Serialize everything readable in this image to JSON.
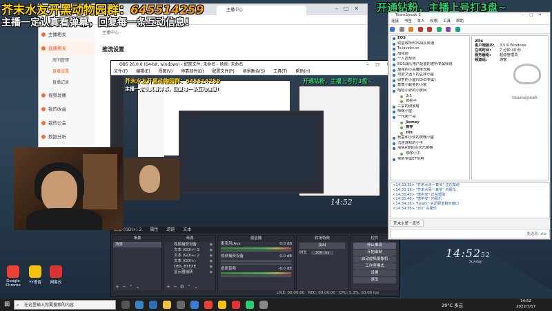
{
  "overlay": {
    "title_line1": "芥末水友开黑动物园群：",
    "qq_number": "645514259",
    "title_line2": "主播一定认真看弹幕，回复每一条互动信息!",
    "right_banner": "开通钻粉，主播上号打3盘~"
  },
  "browser": {
    "tab_title": "主播中心",
    "crumb": "主播中心",
    "section_header": "推流设置",
    "sidebar": [
      {
        "label": "主播相关",
        "type": "group"
      },
      {
        "label": "直播相关",
        "type": "group",
        "active": true
      },
      {
        "label": "房间管理",
        "type": "sub"
      },
      {
        "label": "直播设置",
        "type": "sub",
        "active": true
      },
      {
        "label": "直播记录",
        "type": "sub"
      },
      {
        "label": "视频发播",
        "type": "group"
      },
      {
        "label": "我的收益",
        "type": "group"
      },
      {
        "label": "我的公会",
        "type": "group"
      },
      {
        "label": "数据分析",
        "type": "group"
      }
    ]
  },
  "obs": {
    "title": "OBS 26.0.0 (64-bit, windows) - 配置文件: 未命名 - 场景: 未命名",
    "menu": [
      "文件(F)",
      "编辑(E)",
      "视图(V)",
      "停靠部件(D)",
      "配置文件(P)",
      "场景集合(S)",
      "工具(T)",
      "帮助(H)"
    ],
    "studio_bar": [
      "文本 (GDI+) 2",
      "属性",
      "滤镜",
      "文本"
    ],
    "docks": {
      "scenes_header": "场景",
      "sources_header": "来源",
      "mixer_header": "混音器",
      "transitions_header": "转场特效",
      "controls_header": "控件"
    },
    "scenes": [
      "场景"
    ],
    "sources": [
      "视频捕获设备",
      "文本 (GDI+) 3",
      "文本 (GDI+) 2",
      "文本 (GDI+)",
      "OBS_BTEXE",
      "显示器捕获"
    ],
    "mixer": [
      {
        "name": "麦克风/Aux",
        "value": "0.0 dB",
        "active": true
      },
      {
        "name": "视频捕获设备",
        "value": "0.0 dB",
        "active": false
      },
      {
        "name": "桌面音频",
        "value": "-6.0 dB",
        "active": true
      }
    ],
    "transition": {
      "name": "淡出",
      "duration_label": "时长",
      "duration": "300 ms"
    },
    "controls": [
      "停止推流",
      "开始录制",
      "启动虚拟摄像机",
      "工作室模式",
      "设置",
      "退出"
    ],
    "status": {
      "live": "LIVE: 00:00:00",
      "rec": "REC: 00:00:00",
      "cpu": "CPU: 5.3%, 60.00 fps"
    }
  },
  "teamspeak": {
    "title": "TeamSpeak 3",
    "menu": [
      "连接",
      "书签",
      "本人",
      "权限",
      "工具",
      "帮助"
    ],
    "tree": [
      {
        "label": "EOS",
        "kind": "server",
        "bold": true
      },
      {
        "label": "欢迎收听EOS战队频道",
        "kind": "channel"
      },
      {
        "label": "Ts.lovekv.cn",
        "kind": "channel"
      },
      {
        "label": "加我前",
        "kind": "channel"
      },
      {
        "label": "一人员规则",
        "kind": "channel"
      },
      {
        "label": "EOS战队用户配置的老听专属频道",
        "kind": "channel"
      },
      {
        "label": "最强的小恶魔推流房",
        "kind": "channel"
      },
      {
        "label": "可爱又迷人的豆妹小屋",
        "kind": "channel"
      },
      {
        "label": "绿茶的小屋(YOYO专属)",
        "kind": "channel"
      },
      {
        "label": "蒸蒸小鲸鱼的小家",
        "kind": "channel"
      },
      {
        "label": "哈哈小驴的小房间",
        "kind": "channel"
      },
      {
        "label": "3r5",
        "kind": "user"
      },
      {
        "label": "如把子",
        "kind": "user"
      },
      {
        "label": "二蒙的树家房",
        "kind": "channel"
      },
      {
        "label": "咪咪小屋",
        "kind": "channel"
      },
      {
        "label": "一代用一哥",
        "kind": "channel"
      },
      {
        "label": "jiemey",
        "kind": "user"
      },
      {
        "label": "高梓",
        "kind": "user"
      },
      {
        "label": "zlls",
        "kind": "user"
      },
      {
        "label": "我富和小伙的夜晚小屋",
        "kind": "channel"
      },
      {
        "label": "沉迷游戏的小子",
        "kind": "channel"
      },
      {
        "label": "清情A梦的百次元吸猫",
        "kind": "channel"
      },
      {
        "label": "哆哆小子",
        "kind": "user"
      },
      {
        "label": "依依专属ET专用",
        "kind": "channel"
      }
    ],
    "info": {
      "name": "zlls",
      "rows": [
        {
          "k": "客户端版本:",
          "v": "3.5.6 Windows"
        },
        {
          "k": "在线时间:",
          "v": "7 分钟 40 秒"
        },
        {
          "k": "服务器组:",
          "v": "超级管理员"
        },
        {
          "k": "频道组:",
          "v": "游客"
        }
      ],
      "logo_text": "teamspeak"
    },
    "chat": [
      "<14:33:35> \"芥末水哥一真爷\" 正在帮助",
      "<14:33:39> \"芥末水哥一真爷\" 内服乐",
      "<14:33:40> \"唐中安\" 正在帮助",
      "<14:33:46> \"唐中安\" 内服乐",
      "<14:34:26> \"twam\" 关闭频道聊天窗口",
      "<14:34:36> \"zlls\" 内服乐"
    ],
    "chat_tab": "芥末水哥一真爷",
    "input_hint": "发送到: zlls"
  },
  "clock": {
    "time": "14:52",
    "seconds": "52",
    "sub": "Sunday"
  },
  "desktop_icons": [
    {
      "label": "Google Chrome",
      "color": "#e94235"
    },
    {
      "label": "YY语音",
      "color": "#f4c20d"
    },
    {
      "label": "网易云",
      "color": "#d33"
    }
  ],
  "taskbar": {
    "search_placeholder": "在这里输入你要搜索的内容",
    "weather": "29°C 多云",
    "time": "14:52",
    "date": "2022/7/17"
  },
  "colors": {
    "overlay_yellow": "#ffd400",
    "overlay_green": "#2ecc71",
    "brand_orange": "#ff5a1f"
  }
}
